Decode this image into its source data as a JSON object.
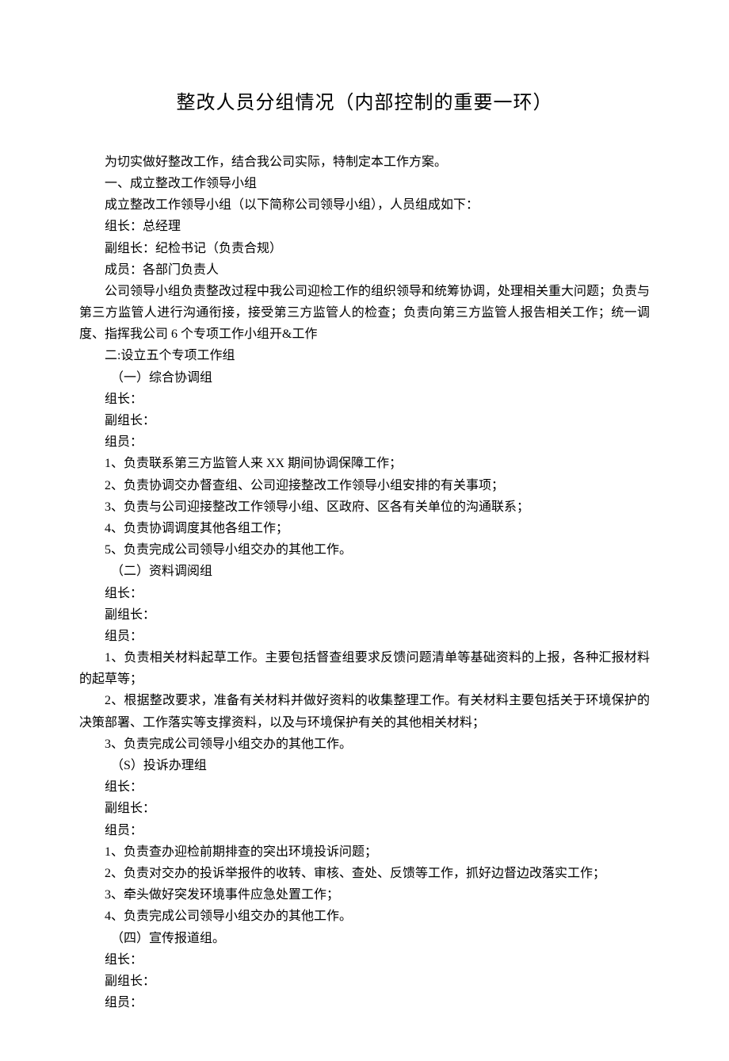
{
  "title": "整改人员分组情况（内部控制的重要一环）",
  "intro": "为切实做好整改工作，结合我公司实际，特制定本工作方案。",
  "section1_heading": "一、成立整改工作领导小组",
  "section1_p1": "成立整改工作领导小组（以下简称公司领导小组），人员组成如下：",
  "section1_p2": "组长：总经理",
  "section1_p3": "副组长：纪检书记（负责合规）",
  "section1_p4": "成员：各部门负责人",
  "section1_p5": "公司领导小组负责整改过程中我公司迎检工作的组织领导和统筹协调，处理相关重大问题；负责与第三方监管人进行沟通衔接，接受第三方监管人的检查；负责向第三方监管人报告相关工作；统一调度、指挥我公司 6 个专项工作小组开&工作",
  "section2_heading": "二:设立五个专项工作组",
  "group1_name": "（一）综合协调组",
  "group1_leader": "组长：",
  "group1_vice": "副组长：",
  "group1_member": "组员：",
  "group1_item1": "1、负责联系第三方监管人来 XX 期间协调保障工作；",
  "group1_item2": "2、负责协调交办督查组、公司迎接整改工作领导小组安排的有关事项；",
  "group1_item3": "3、负责与公司迎接整改工作领导小组、区政府、区各有关单位的沟通联系；",
  "group1_item4": "4、负责协调调度其他各组工作；",
  "group1_item5": "5、负责完成公司领导小组交办的其他工作。",
  "group2_name": "（二）资料调阅组",
  "group2_leader": "组长：",
  "group2_vice": "副组长：",
  "group2_member": "组员：",
  "group2_item1": "1、负责相关材料起草工作。主要包括督查组要求反馈问题清单等基础资料的上报，各种汇报材料的起草等；",
  "group2_item2": "2、根据整改要求，准备有关材料并做好资料的收集整理工作。有关材料主要包括关于环境保护的决策部署、工作落实等支撑资料，以及与环境保护有关的其他相关材料；",
  "group2_item3": "3、负责完成公司领导小组交办的其他工作。",
  "group3_name": "（S）投诉办理组",
  "group3_leader": "组长：",
  "group3_vice": "副组长：",
  "group3_member": "组员：",
  "group3_item1": "1、负责查办迎检前期排查的突出环境投诉问题；",
  "group3_item2": "2、负责对交办的投诉举报件的收转、审核、查处、反馈等工作，抓好边督边改落实工作；",
  "group3_item3": "3、牵头做好突发环境事件应急处置工作；",
  "group3_item4": "4、负责完成公司领导小组交办的其他工作。",
  "group4_name": "（四）宣传报道组。",
  "group4_leader": "组长：",
  "group4_vice": "副组长：",
  "group4_member": "组员："
}
